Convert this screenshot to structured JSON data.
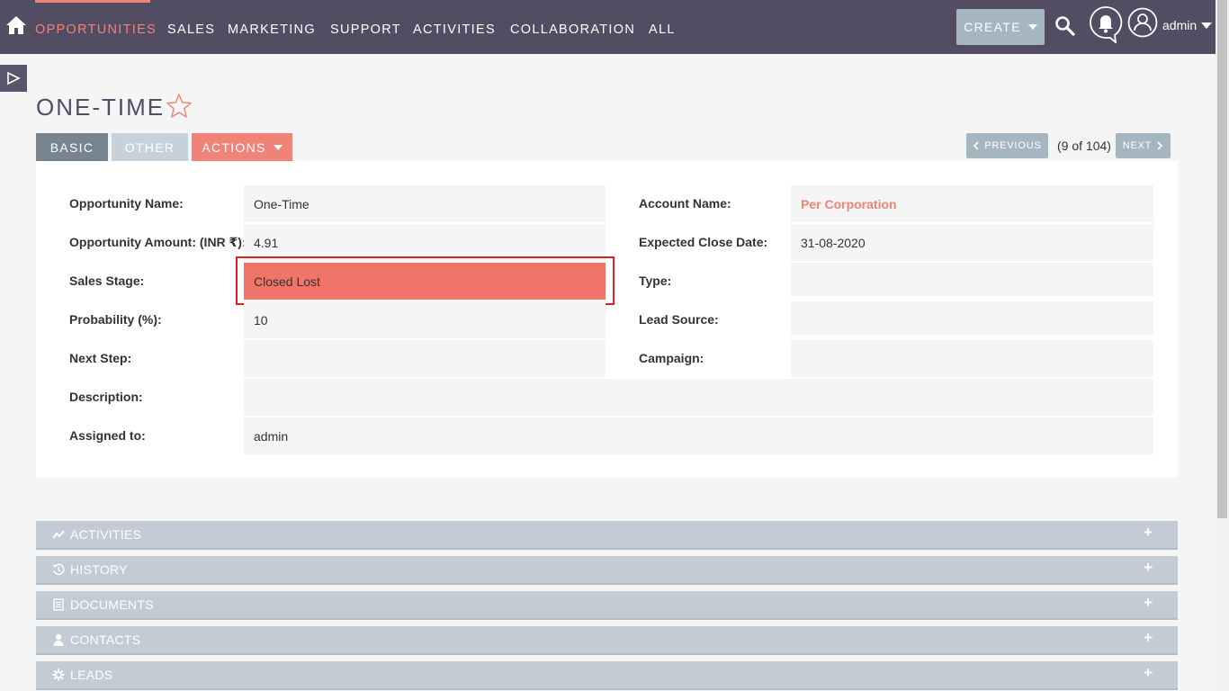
{
  "nav": {
    "items": [
      "OPPORTUNITIES",
      "SALES",
      "MARKETING",
      "SUPPORT",
      "ACTIVITIES",
      "COLLABORATION",
      "ALL"
    ],
    "create_label": "CREATE",
    "user": "admin"
  },
  "record": {
    "title": "ONE-TIME"
  },
  "tabs": {
    "basic": "BASIC",
    "other": "OTHER",
    "actions": "ACTIONS"
  },
  "pagination": {
    "previous": "PREVIOUS",
    "next": "NEXT",
    "count": "(9 of 104)"
  },
  "fields": {
    "opportunity_name": {
      "label": "Opportunity Name:",
      "value": "One-Time"
    },
    "opportunity_amount": {
      "label": "Opportunity Amount: (INR ₹):",
      "value": "4.91"
    },
    "sales_stage": {
      "label": "Sales Stage:",
      "value": "Closed Lost"
    },
    "probability": {
      "label": "Probability (%):",
      "value": "10"
    },
    "next_step": {
      "label": "Next Step:",
      "value": ""
    },
    "description": {
      "label": "Description:",
      "value": ""
    },
    "assigned_to": {
      "label": "Assigned to:",
      "value": "admin"
    },
    "account_name": {
      "label": "Account Name:",
      "value": "Per Corporation"
    },
    "expected_close_date": {
      "label": "Expected Close Date:",
      "value": "31-08-2020"
    },
    "type": {
      "label": "Type:",
      "value": ""
    },
    "lead_source": {
      "label": "Lead Source:",
      "value": ""
    },
    "campaign": {
      "label": "Campaign:",
      "value": ""
    }
  },
  "subpanels": [
    "ACTIVITIES",
    "HISTORY",
    "DOCUMENTS",
    "CONTACTS",
    "LEADS"
  ],
  "colors": {
    "nav_bg": "#534d64",
    "accent": "#f08377",
    "stage_closed_lost": "#f07468",
    "highlight": "#d6202a"
  }
}
